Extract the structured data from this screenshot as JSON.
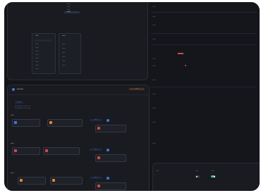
{
  "top_panel": {
    "menu_items": [
      "Label",
      "Label",
      "Label",
      "Label"
    ],
    "left_list_header": "Label",
    "right_list_header": "Label",
    "left_list": [
      "Label",
      "Label",
      "Label",
      "Label",
      "Label",
      "Label",
      "Label",
      "Label"
    ],
    "right_list": [
      "Label",
      "Label",
      "Label",
      "Label",
      "Label",
      "Label"
    ]
  },
  "side_form": {
    "rows": [
      "Label",
      "Label",
      "Label",
      "Label",
      "Label",
      "Label",
      "Label",
      "Label",
      "Label",
      "Label",
      "Label"
    ],
    "section": "Label"
  },
  "workflow": {
    "title": "Workflow",
    "action": "Label",
    "tab": "Label",
    "description": "Description text line one",
    "description2": "Description text line two",
    "groups": [
      "Label",
      "Label",
      "Label"
    ],
    "node_title": "Label",
    "node_sub": "Label",
    "connector_label": "Label"
  },
  "bottom_right": {
    "label1": "Label",
    "label2": "Label",
    "label3": "Label"
  },
  "colors": {
    "accent_blue": "#3b7bd9",
    "accent_red": "#d04a4a",
    "accent_orange": "#d7893a",
    "accent_green": "#4cc38a"
  }
}
